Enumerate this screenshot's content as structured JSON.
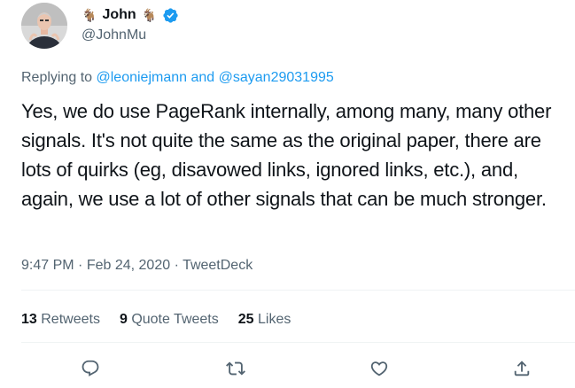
{
  "author": {
    "display_name": "John",
    "handle": "@JohnMu",
    "name_emoji_left": "🐐",
    "name_emoji_right": "🐐",
    "verified": true
  },
  "reply_context": {
    "prefix": "Replying to",
    "mention_1": "@leoniejmann",
    "conjunction": "and",
    "mention_2": "@sayan29031995"
  },
  "tweet_text": "Yes, we do use PageRank internally, among many, many other signals. It's not quite the same as the original paper, there are lots of quirks (eg, disavowed links, ignored links, etc.), and, again, we use a lot of other signals that can be much stronger.",
  "meta": {
    "time": "9:47 PM",
    "separator": "·",
    "date": "Feb 24, 2020",
    "source": "TweetDeck"
  },
  "stats": {
    "retweets_count": "13",
    "retweets_label": "Retweets",
    "quote_count": "9",
    "quote_label": "Quote Tweets",
    "likes_count": "25",
    "likes_label": "Likes"
  },
  "actions": [
    "reply-icon",
    "retweet-icon",
    "like-icon",
    "share-icon"
  ],
  "colors": {
    "link": "#1d9bf0",
    "secondary_text": "#536471",
    "primary_text": "#0f1419",
    "verified_badge": "#1d9bf0"
  }
}
